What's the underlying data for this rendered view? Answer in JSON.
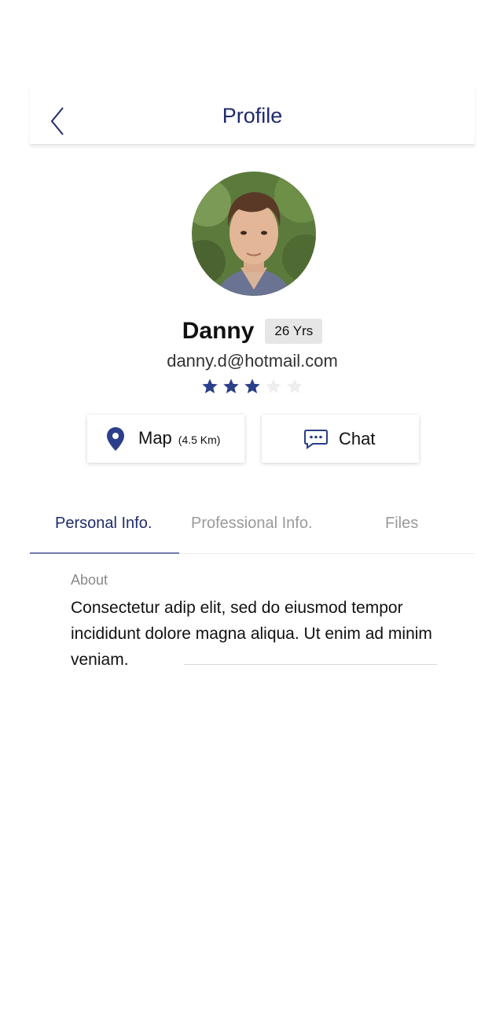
{
  "header": {
    "title": "Profile",
    "back_icon": "chevron-left-icon"
  },
  "profile": {
    "name": "Danny",
    "age_badge": "26 Yrs",
    "email": "danny.d@hotmail.com",
    "rating": 3,
    "rating_max": 5
  },
  "actions": {
    "map": {
      "label": "Map",
      "distance": "(4.5 Km)",
      "icon": "map-pin-icon"
    },
    "chat": {
      "label": "Chat",
      "icon": "chat-bubble-icon"
    }
  },
  "tabs": [
    {
      "label": "Personal Info.",
      "active": true
    },
    {
      "label": "Professional Info.",
      "active": false
    },
    {
      "label": "Files",
      "active": false
    }
  ],
  "about": {
    "label": "About",
    "text": "Consectetur adip elit, sed do eiusmod tempor incididunt dolore magna aliqua. Ut enim ad minim veniam."
  },
  "colors": {
    "accent": "#1f2b6c",
    "star_filled": "#2b3f8a",
    "star_empty": "#eeeeee",
    "muted": "#9a9a9a"
  }
}
